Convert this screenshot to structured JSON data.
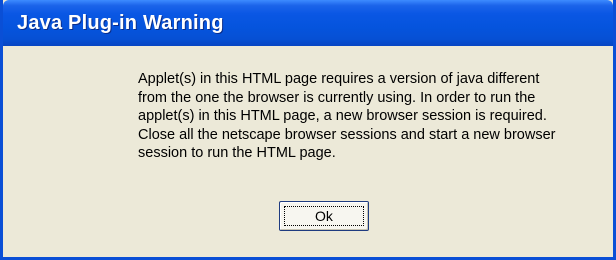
{
  "dialog": {
    "title": "Java Plug-in Warning",
    "message_lines": [
      "Applet(s) in this HTML page requires a version of java different",
      "from the one the browser is currently using. In order to run the",
      "applet(s) in this HTML page, a new browser session is required.",
      "Close all the netscape browser sessions and start a new browser",
      "session to run the HTML page."
    ],
    "ok_label": "Ok"
  },
  "colors": {
    "titlebar": "#0554dd",
    "window_body": "#ece9d8",
    "frame": "#0a4fd6"
  }
}
